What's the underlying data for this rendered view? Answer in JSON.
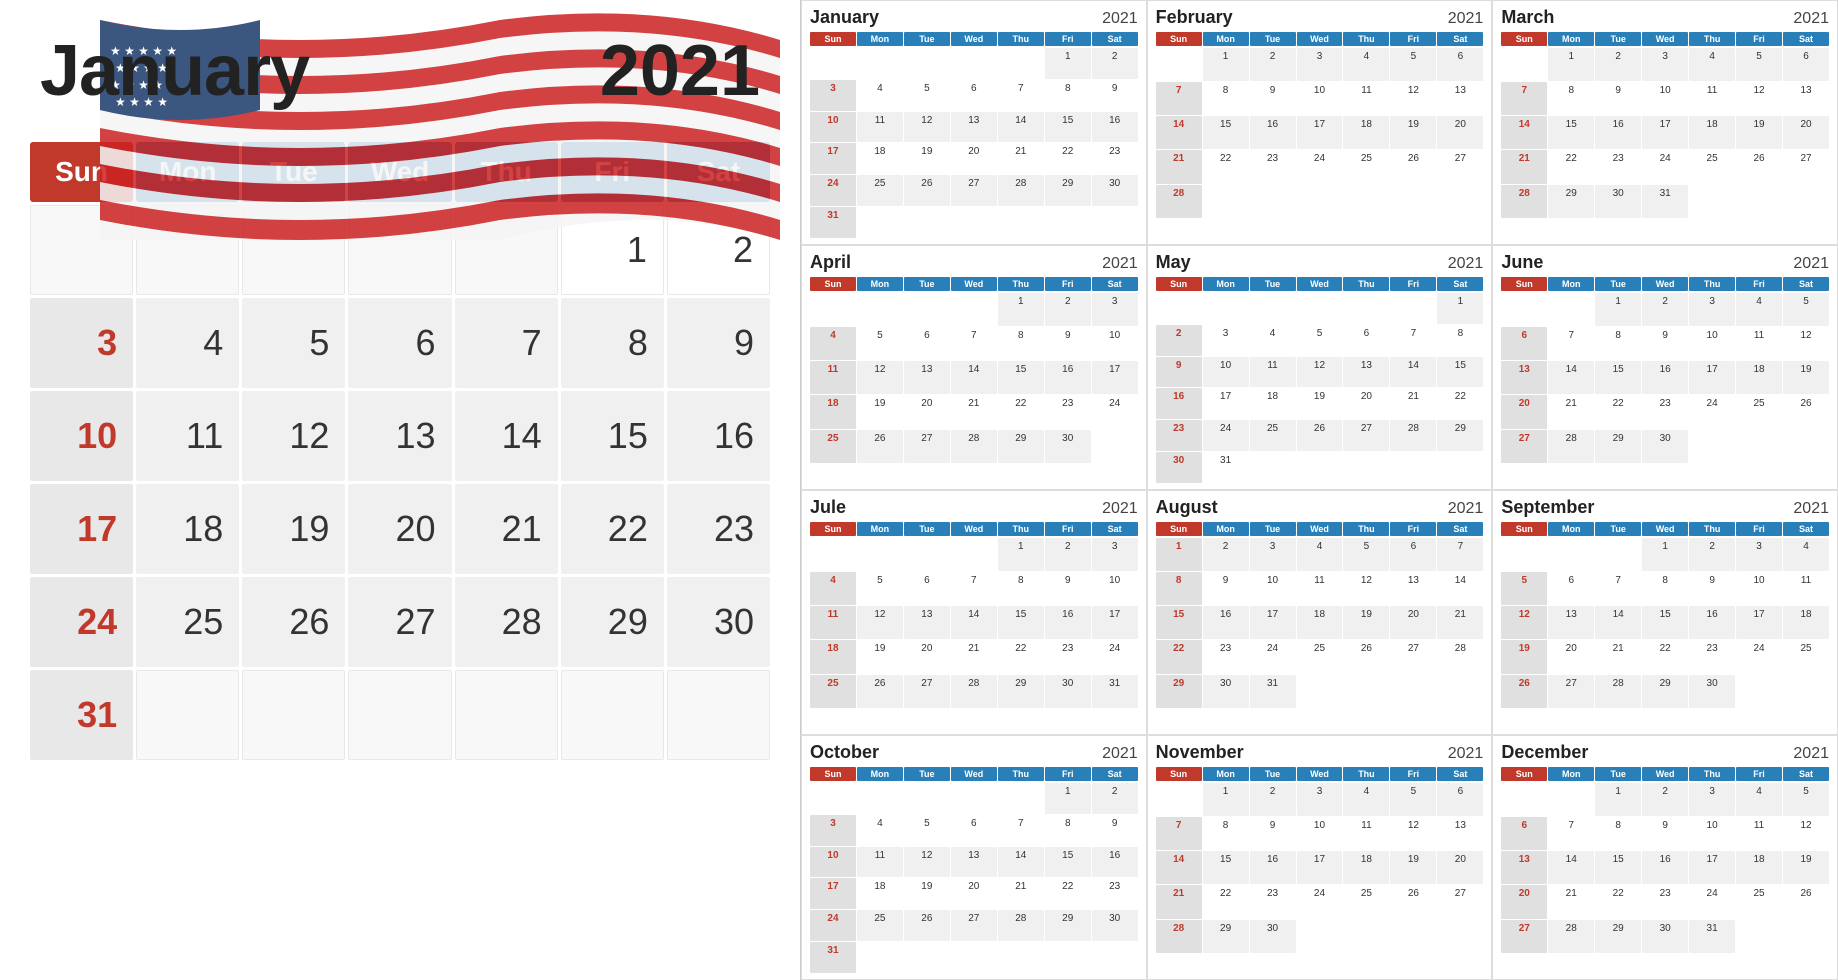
{
  "left": {
    "month": "January",
    "year": "2021",
    "days_header": [
      "Sun",
      "Mon",
      "Tue",
      "Wed",
      "Thu",
      "Fri",
      "Sat"
    ],
    "weeks": [
      [
        "",
        "",
        "",
        "",
        "",
        "1",
        "2"
      ],
      [
        "3",
        "4",
        "5",
        "6",
        "7",
        "8",
        "9"
      ],
      [
        "10",
        "11",
        "12",
        "13",
        "14",
        "15",
        "16"
      ],
      [
        "17",
        "18",
        "19",
        "20",
        "21",
        "22",
        "23"
      ],
      [
        "24",
        "25",
        "26",
        "27",
        "28",
        "29",
        "30"
      ],
      [
        "31",
        "",
        "",
        "",
        "",
        "",
        ""
      ]
    ]
  },
  "right": [
    {
      "month": "January",
      "year": "2021",
      "weeks": [
        [
          "",
          "",
          "",
          "",
          "",
          "1",
          "2"
        ],
        [
          "3",
          "4",
          "5",
          "6",
          "7",
          "8",
          "9"
        ],
        [
          "10",
          "11",
          "12",
          "13",
          "14",
          "15",
          "16"
        ],
        [
          "17",
          "18",
          "19",
          "20",
          "21",
          "22",
          "23"
        ],
        [
          "24",
          "25",
          "26",
          "27",
          "28",
          "29",
          "30"
        ],
        [
          "31",
          "",
          "",
          "",
          "",
          "",
          ""
        ]
      ]
    },
    {
      "month": "February",
      "year": "2021",
      "weeks": [
        [
          "",
          "1",
          "2",
          "3",
          "4",
          "5",
          "6"
        ],
        [
          "7",
          "8",
          "9",
          "10",
          "11",
          "12",
          "13"
        ],
        [
          "14",
          "15",
          "16",
          "17",
          "18",
          "19",
          "20"
        ],
        [
          "21",
          "22",
          "23",
          "24",
          "25",
          "26",
          "27"
        ],
        [
          "28",
          "",
          "",
          "",
          "",
          "",
          ""
        ],
        [
          "",
          "",
          "",
          "",
          "",
          "",
          ""
        ]
      ]
    },
    {
      "month": "March",
      "year": "2021",
      "weeks": [
        [
          "",
          "1",
          "2",
          "3",
          "4",
          "5",
          "6"
        ],
        [
          "7",
          "8",
          "9",
          "10",
          "11",
          "12",
          "13"
        ],
        [
          "14",
          "15",
          "16",
          "17",
          "18",
          "19",
          "20"
        ],
        [
          "21",
          "22",
          "23",
          "24",
          "25",
          "26",
          "27"
        ],
        [
          "28",
          "29",
          "30",
          "31",
          "",
          "",
          ""
        ],
        [
          "",
          "",
          "",
          "",
          "",
          "",
          ""
        ]
      ]
    },
    {
      "month": "April",
      "year": "2021",
      "weeks": [
        [
          "",
          "",
          "",
          "",
          "1",
          "2",
          "3"
        ],
        [
          "4",
          "5",
          "6",
          "7",
          "8",
          "9",
          "10"
        ],
        [
          "11",
          "12",
          "13",
          "14",
          "15",
          "16",
          "17"
        ],
        [
          "18",
          "19",
          "20",
          "21",
          "22",
          "23",
          "24"
        ],
        [
          "25",
          "26",
          "27",
          "28",
          "29",
          "30",
          ""
        ],
        [
          "",
          "",
          "",
          "",
          "",
          "",
          ""
        ]
      ]
    },
    {
      "month": "May",
      "year": "2021",
      "weeks": [
        [
          "",
          "",
          "",
          "",
          "",
          "",
          "1"
        ],
        [
          "2",
          "3",
          "4",
          "5",
          "6",
          "7",
          "8"
        ],
        [
          "9",
          "10",
          "11",
          "12",
          "13",
          "14",
          "15"
        ],
        [
          "16",
          "17",
          "18",
          "19",
          "20",
          "21",
          "22"
        ],
        [
          "23",
          "24",
          "25",
          "26",
          "27",
          "28",
          "29"
        ],
        [
          "30",
          "31",
          "",
          "",
          "",
          "",
          ""
        ]
      ]
    },
    {
      "month": "June",
      "year": "2021",
      "weeks": [
        [
          "",
          "",
          "1",
          "2",
          "3",
          "4",
          "5"
        ],
        [
          "6",
          "7",
          "8",
          "9",
          "10",
          "11",
          "12"
        ],
        [
          "13",
          "14",
          "15",
          "16",
          "17",
          "18",
          "19"
        ],
        [
          "20",
          "21",
          "22",
          "23",
          "24",
          "25",
          "26"
        ],
        [
          "27",
          "28",
          "29",
          "30",
          "",
          "",
          ""
        ],
        [
          "",
          "",
          "",
          "",
          "",
          "",
          ""
        ]
      ]
    },
    {
      "month": "Jule",
      "year": "2021",
      "weeks": [
        [
          "",
          "",
          "",
          "",
          "1",
          "2",
          "3"
        ],
        [
          "4",
          "5",
          "6",
          "7",
          "8",
          "9",
          "10"
        ],
        [
          "11",
          "12",
          "13",
          "14",
          "15",
          "16",
          "17"
        ],
        [
          "18",
          "19",
          "20",
          "21",
          "22",
          "23",
          "24"
        ],
        [
          "25",
          "26",
          "27",
          "28",
          "29",
          "30",
          "31"
        ],
        [
          "",
          "",
          "",
          "",
          "",
          "",
          ""
        ]
      ]
    },
    {
      "month": "August",
      "year": "2021",
      "weeks": [
        [
          "1",
          "2",
          "3",
          "4",
          "5",
          "6",
          "7"
        ],
        [
          "8",
          "9",
          "10",
          "11",
          "12",
          "13",
          "14"
        ],
        [
          "15",
          "16",
          "17",
          "18",
          "19",
          "20",
          "21"
        ],
        [
          "22",
          "23",
          "24",
          "25",
          "26",
          "27",
          "28"
        ],
        [
          "29",
          "30",
          "31",
          "",
          "",
          "",
          ""
        ],
        [
          "",
          "",
          "",
          "",
          "",
          "",
          ""
        ]
      ]
    },
    {
      "month": "September",
      "year": "2021",
      "weeks": [
        [
          "",
          "",
          "",
          "1",
          "2",
          "3",
          "4"
        ],
        [
          "5",
          "6",
          "7",
          "8",
          "9",
          "10",
          "11"
        ],
        [
          "12",
          "13",
          "14",
          "15",
          "16",
          "17",
          "18"
        ],
        [
          "19",
          "20",
          "21",
          "22",
          "23",
          "24",
          "25"
        ],
        [
          "26",
          "27",
          "28",
          "29",
          "30",
          "",
          ""
        ],
        [
          "",
          "",
          "",
          "",
          "",
          "",
          ""
        ]
      ]
    },
    {
      "month": "October",
      "year": "2021",
      "weeks": [
        [
          "",
          "",
          "",
          "",
          "",
          "1",
          "2"
        ],
        [
          "3",
          "4",
          "5",
          "6",
          "7",
          "8",
          "9"
        ],
        [
          "10",
          "11",
          "12",
          "13",
          "14",
          "15",
          "16"
        ],
        [
          "17",
          "18",
          "19",
          "20",
          "21",
          "22",
          "23"
        ],
        [
          "24",
          "25",
          "26",
          "27",
          "28",
          "29",
          "30"
        ],
        [
          "31",
          "",
          "",
          "",
          "",
          "",
          ""
        ]
      ]
    },
    {
      "month": "November",
      "year": "2021",
      "weeks": [
        [
          "",
          "1",
          "2",
          "3",
          "4",
          "5",
          "6"
        ],
        [
          "7",
          "8",
          "9",
          "10",
          "11",
          "12",
          "13"
        ],
        [
          "14",
          "15",
          "16",
          "17",
          "18",
          "19",
          "20"
        ],
        [
          "21",
          "22",
          "23",
          "24",
          "25",
          "26",
          "27"
        ],
        [
          "28",
          "29",
          "30",
          "",
          "",
          "",
          ""
        ],
        [
          "",
          "",
          "",
          "",
          "",
          "",
          ""
        ]
      ]
    },
    {
      "month": "December",
      "year": "2021",
      "weeks": [
        [
          "",
          "",
          "1",
          "2",
          "3",
          "4",
          "5"
        ],
        [
          "6",
          "7",
          "8",
          "9",
          "10",
          "11",
          "12"
        ],
        [
          "13",
          "14",
          "15",
          "16",
          "17",
          "18",
          "19"
        ],
        [
          "20",
          "21",
          "22",
          "23",
          "24",
          "25",
          "26"
        ],
        [
          "27",
          "28",
          "29",
          "30",
          "31",
          "",
          ""
        ],
        [
          "",
          "",
          "",
          "",
          "",
          "",
          ""
        ]
      ]
    }
  ],
  "days_short": [
    "Sun",
    "Mon",
    "Tue",
    "Wed",
    "Thu",
    "Fri",
    "Sat"
  ]
}
